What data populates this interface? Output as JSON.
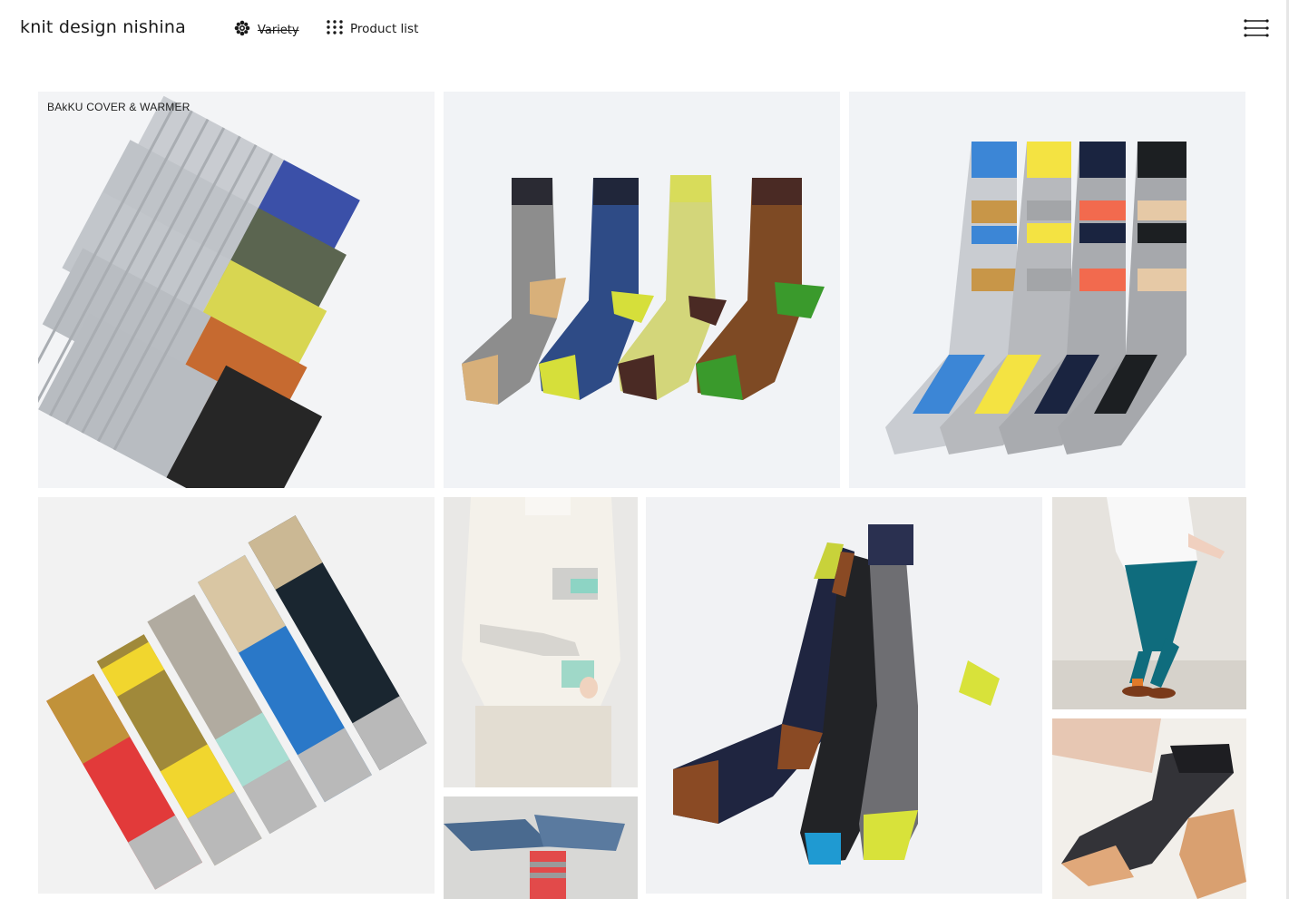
{
  "header": {
    "brand": "knit design nishina",
    "nav": [
      {
        "label": "Variety",
        "icon": "flower-icon",
        "struck": true
      },
      {
        "label": "Product list",
        "icon": "grid-dots-icon"
      }
    ],
    "menu_icon": "menu-lines-icon"
  },
  "gallery": {
    "tiles": [
      {
        "id": "bakku-cover-warmer",
        "label": "BAkKU COVER & WARMER"
      },
      {
        "id": "cable-socks-four"
      },
      {
        "id": "striped-socks-four"
      },
      {
        "id": "colorblock-socks-five"
      },
      {
        "id": "arm-warmer-model"
      },
      {
        "id": "navy-cable-socks-three"
      },
      {
        "id": "walking-model"
      },
      {
        "id": "jeans-socks-closeup"
      },
      {
        "id": "cable-sock-foot"
      }
    ]
  }
}
